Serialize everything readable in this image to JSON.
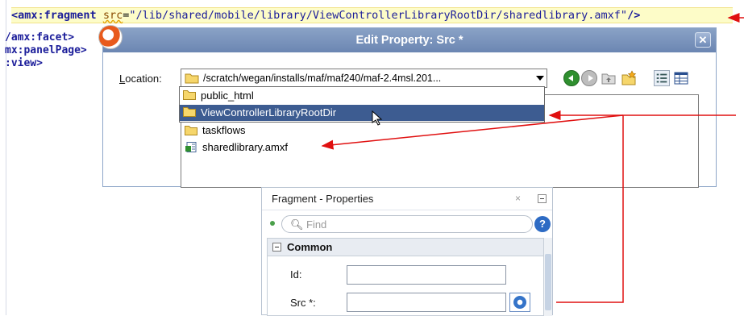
{
  "editor": {
    "line1": {
      "tag": "<amx:fragment",
      "attr": "src",
      "eq": "=",
      "value": "\"/lib/shared/mobile/library/ViewControllerLibraryRootDir/sharedlibrary.amxf\"",
      "close": "/>"
    },
    "line2": "/amx:facet>",
    "line3": "mx:panelPage>",
    "line4": ":view>"
  },
  "dialog": {
    "title": "Edit Property: Src *",
    "close_glyph": "✕",
    "location_label_prefix": "",
    "location_label_underlined": "L",
    "location_label_rest": "ocation:",
    "location_value": "/scratch/wegan/installs/maf/maf240/maf-2.4msl.201...",
    "dropdown_items": [
      {
        "label": "public_html",
        "selected": false
      },
      {
        "label": "ViewControllerLibraryRootDir",
        "selected": true
      }
    ],
    "file_items": [
      {
        "label": "taskflows",
        "icon": "folder-icon"
      },
      {
        "label": "sharedlibrary.amxf",
        "icon": "amx-file-icon"
      }
    ]
  },
  "props": {
    "title": "Fragment - Properties",
    "close_glyph": "×",
    "search_placeholder": "Find",
    "help_glyph": "?",
    "section": "Common",
    "fields": [
      {
        "label": "Id:",
        "value": ""
      },
      {
        "label": "Src *:",
        "value": ""
      }
    ]
  },
  "colors": {
    "annotation_arrow": "#e01010",
    "selection": "#3d5c91",
    "title_bar": "#7a93bd"
  }
}
